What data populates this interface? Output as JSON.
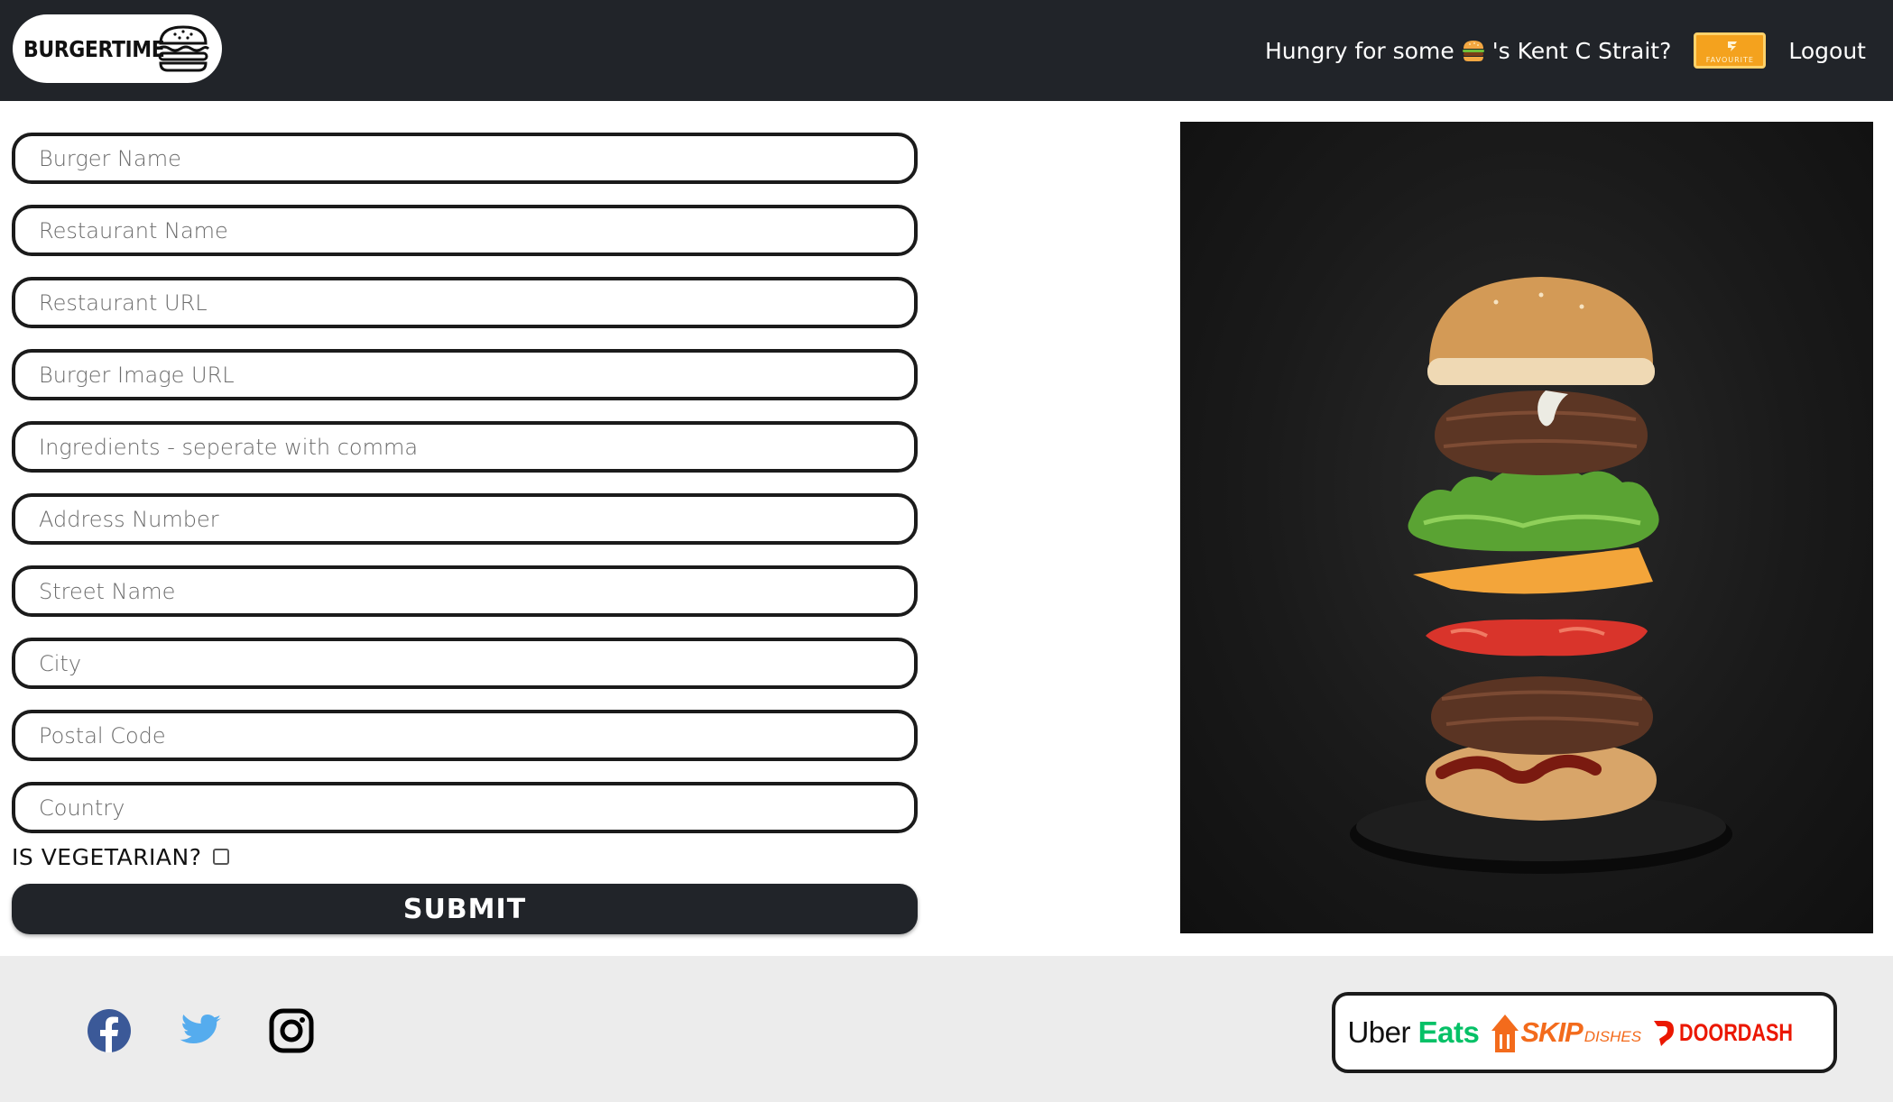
{
  "header": {
    "brand": "BURGERTIME",
    "greeting_before": "Hungry for some",
    "greeting_emoji": "burger-emoji",
    "greeting_after": "'s Kent C Strait?",
    "favourite_label": "FAVOURITE",
    "logout_label": "Logout"
  },
  "form": {
    "fields": [
      {
        "placeholder": "Burger Name",
        "value": ""
      },
      {
        "placeholder": "Restaurant Name",
        "value": ""
      },
      {
        "placeholder": "Restaurant URL",
        "value": ""
      },
      {
        "placeholder": "Burger Image URL",
        "value": ""
      },
      {
        "placeholder": "Ingredients - seperate with comma",
        "value": ""
      },
      {
        "placeholder": "Address Number",
        "value": ""
      },
      {
        "placeholder": "Street Name",
        "value": ""
      },
      {
        "placeholder": "City",
        "value": ""
      },
      {
        "placeholder": "Postal Code",
        "value": ""
      },
      {
        "placeholder": "Country",
        "value": ""
      }
    ],
    "vegetarian_label": "IS VEGETARIAN?",
    "vegetarian_checked": false,
    "submit_label": "SUBMIT"
  },
  "footer": {
    "social": [
      "facebook-icon",
      "twitter-icon",
      "instagram-icon"
    ],
    "delivery": {
      "uber_part1": "Uber",
      "uber_part2": "Eats",
      "skip_main": "SKIP",
      "skip_sub": "DISHES",
      "doordash": "DOORDASH"
    }
  },
  "colors": {
    "navbar": "#212429",
    "footer": "#ececec",
    "facebook": "#3b5998",
    "twitter": "#55acee",
    "uber_eats_green": "#06c167",
    "skip_orange": "#f36b1c",
    "doordash_red": "#eb1700"
  }
}
